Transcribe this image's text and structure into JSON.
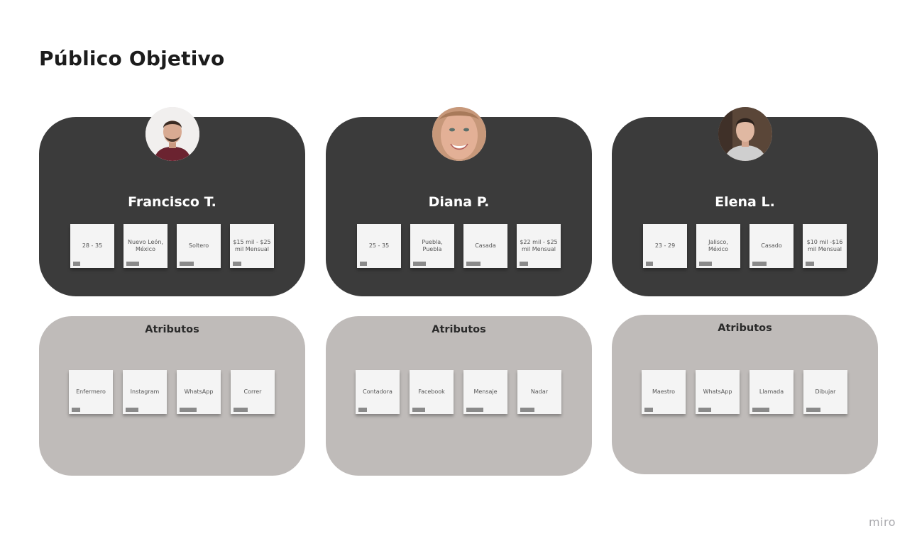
{
  "page": {
    "title": "Público Objetivo",
    "brand": "miro"
  },
  "personas": [
    {
      "name": "Francisco T.",
      "notes": [
        "28 - 35",
        "Nuevo León, México",
        "Soltero",
        "$15 mil - $25 mil Mensual"
      ],
      "attributes_title": "Atributos",
      "attributes": [
        "Enfermero",
        "Instagram",
        "WhatsApp",
        "Correr"
      ]
    },
    {
      "name": "Diana P.",
      "notes": [
        "25 - 35",
        "Puebla, Puebla",
        "Casada",
        "$22 mil - $25 mil Mensual"
      ],
      "attributes_title": "Atributos",
      "attributes": [
        "Contadora",
        "Facebook",
        "Mensaje",
        "Nadar"
      ]
    },
    {
      "name": "Elena L.",
      "notes": [
        "23 - 29",
        "Jalisco, México",
        "Casado",
        "$10 mil -$16 mil Mensual"
      ],
      "attributes_title": "Atributos",
      "attributes": [
        "Maestro",
        "WhatsApp",
        "Llamada",
        "Dibujar"
      ]
    }
  ],
  "colors": {
    "persona_card": "#3b3b3b",
    "attribute_card": "#bfbbb9",
    "sticky_note": "#f4f4f4",
    "note_tag": "#8a8a8a"
  }
}
